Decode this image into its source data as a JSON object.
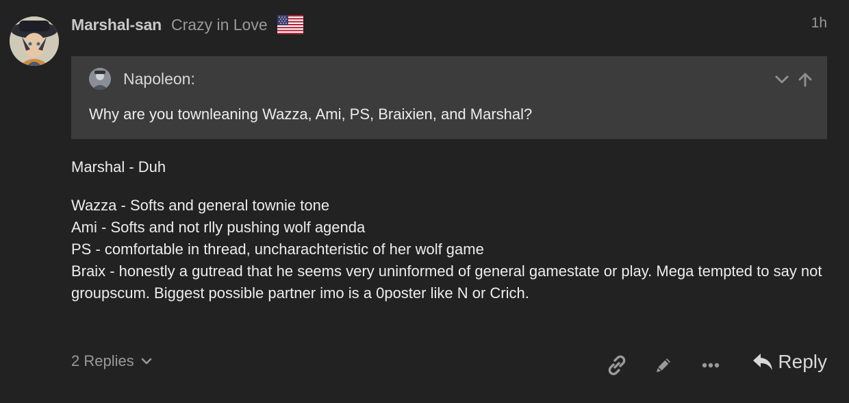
{
  "post": {
    "username": "Marshal-san",
    "user_title": "Crazy in Love",
    "flag_icon": "us-flag-icon",
    "date": "1h",
    "quote": {
      "author": "Napoleon:",
      "text": "Why are you townleaning Wazza, Ami, PS, Braixien, and Marshal?",
      "controls": [
        "chevron-down-icon",
        "arrow-up-icon"
      ]
    },
    "body": {
      "paragraph1": "Marshal - Duh",
      "lines": [
        "Wazza - Softs and general townie tone",
        "Ami - Softs and not rlly pushing wolf agenda",
        "PS - comfortable in thread, uncharachteristic of her wolf game",
        "Braix - honestly a gutread that he seems very uninformed of general gamestate or play. Mega tempted to say not groupscum. Biggest possible partner imo is a 0poster like N or Crich."
      ]
    },
    "actions": {
      "replies_label": "2 Replies",
      "reply_label": "Reply",
      "icons": [
        "link-icon",
        "pencil-icon",
        "more-icon",
        "reply-icon"
      ]
    }
  },
  "colors": {
    "background": "#222222",
    "quote_background": "#3c3c3c",
    "primary_text": "#ededed",
    "muted_text": "#9a9a9a"
  }
}
